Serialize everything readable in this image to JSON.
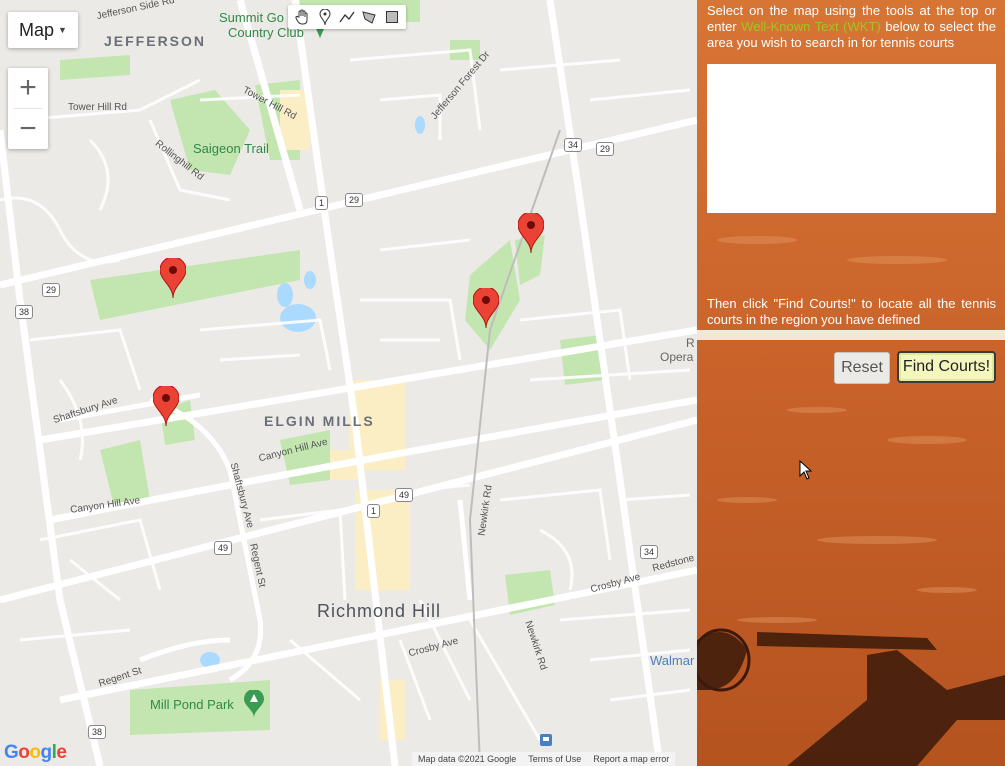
{
  "map": {
    "type_control": {
      "label": "Map"
    },
    "zoom": {
      "in_label": "+",
      "out_label": "−"
    },
    "draw_tools": [
      "hand-icon",
      "marker-icon",
      "polyline-icon",
      "polygon-icon",
      "rectangle-icon"
    ],
    "place_labels": {
      "jefferson": "JEFFERSON",
      "elgin_mills": "ELGIN MILLS",
      "richmond_hill": "Richmond Hill",
      "saigeon_trail": "Saigeon Trail",
      "summit_golf": "Summit Go",
      "country_club": "Country Club",
      "mill_pond_park": "Mill Pond Park",
      "walmart": "Walmar",
      "opera": "Opera",
      "r_partial": "R"
    },
    "street_labels": {
      "jefferson_side_rd": "Jefferson Side Rd",
      "tower_hill_rd_1": "Tower Hill Rd",
      "tower_hill_rd_2": "Tower Hill Rd",
      "jefferson_forest_dr": "Jefferson Forest Dr",
      "rollinghill_rd": "Rollinghill Rd",
      "shaftsbury_ave_1": "Shaftsbury Ave",
      "shaftsbury_ave_2": "Shaftsbury Ave",
      "canyon_hill_ave_1": "Canyon Hill Ave",
      "canyon_hill_ave_2": "Canyon Hill Ave",
      "regent_st_1": "Regent St",
      "regent_st_2": "Regent St",
      "newkirk_rd_1": "Newkirk Rd",
      "newkirk_rd_2": "Newkirk Rd",
      "crosby_ave_1": "Crosby Ave",
      "crosby_ave_2": "Crosby Ave",
      "redstone": "Redstone"
    },
    "route_shields": [
      "1",
      "29",
      "34",
      "29",
      "29",
      "38",
      "49",
      "1",
      "49",
      "34",
      "38"
    ],
    "pins": [
      {
        "name": "tennis-court-pin-1"
      },
      {
        "name": "tennis-court-pin-2"
      },
      {
        "name": "tennis-court-pin-3"
      },
      {
        "name": "tennis-court-pin-4"
      }
    ],
    "colors": {
      "pin": "#ea4335",
      "park": "#c3e6b0",
      "road": "#ffffff",
      "highway": "#fbe4a0"
    },
    "google_logo": {
      "G": "G",
      "o1": "o",
      "o2": "o",
      "g": "g",
      "l": "l",
      "e": "e"
    },
    "attribution": {
      "map_data": "Map data ©2021 Google",
      "terms": "Terms of Use",
      "report": "Report a map error"
    }
  },
  "panel": {
    "instructions_before_link": "Select on the map using the tools at the top or enter",
    "wkt_link": "Well-Known Text (WKT)",
    "instructions_after_link": "below to select the area you wish to search in for tennis courts",
    "wkt_input_value": "",
    "then_text": "Then click \"Find Courts!\" to locate all the tennis courts in the region you have defined",
    "reset_label": "Reset",
    "find_label": "Find Courts!",
    "link_color": "#a3c41f"
  }
}
